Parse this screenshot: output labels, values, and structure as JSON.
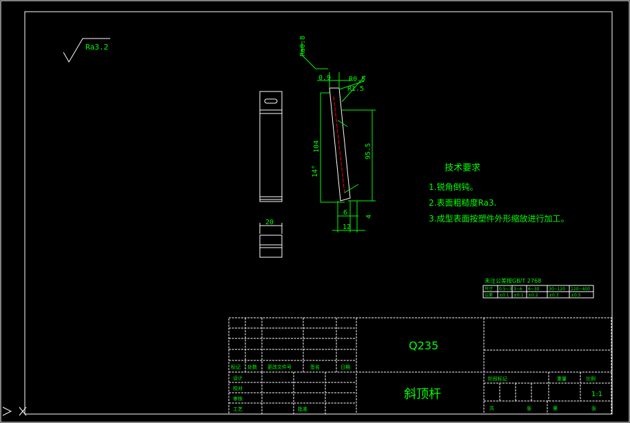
{
  "roughness_symbol": {
    "value": "Ra3.2"
  },
  "side_view": {
    "roughness": "Ra0.8",
    "dims": {
      "top_offset": "0.9",
      "r1": "R0.5",
      "r2": "R1.5",
      "length_left": "104",
      "length_right": "95.5",
      "angle": "14°",
      "small_offset": "4",
      "bottom_a": "6",
      "bottom_b": "12"
    }
  },
  "width_dim": "20",
  "tech_requirements": {
    "title": "技术要求",
    "items": [
      "1.锐角倒钝。",
      "2.表面粗糙度Ra3.",
      "3.成型表面按塑件外形缩放进行加工。"
    ]
  },
  "tolerance_table": {
    "caption": "未注公差按GB/T 2768",
    "headers": [
      "尺寸",
      "0.5~3",
      "3~6",
      "6~30",
      "30~120",
      "120~400"
    ],
    "values": [
      "公差",
      "±0.1",
      "±0.1",
      "±0.2",
      "±0.3",
      "±0.5"
    ]
  },
  "title_block": {
    "material": "Q235",
    "part_name": "斜顶杆",
    "scale": "1:1",
    "left_labels": [
      "标记",
      "处数",
      "更改文件号",
      "签名",
      "日期"
    ],
    "left_labels2": [
      "设计",
      "校对",
      "审核",
      "工艺",
      "批准"
    ],
    "mid_labels": [
      "阶段标记",
      "重量",
      "比例"
    ],
    "bottom_labels": [
      "共",
      "张",
      "第",
      "张"
    ]
  }
}
